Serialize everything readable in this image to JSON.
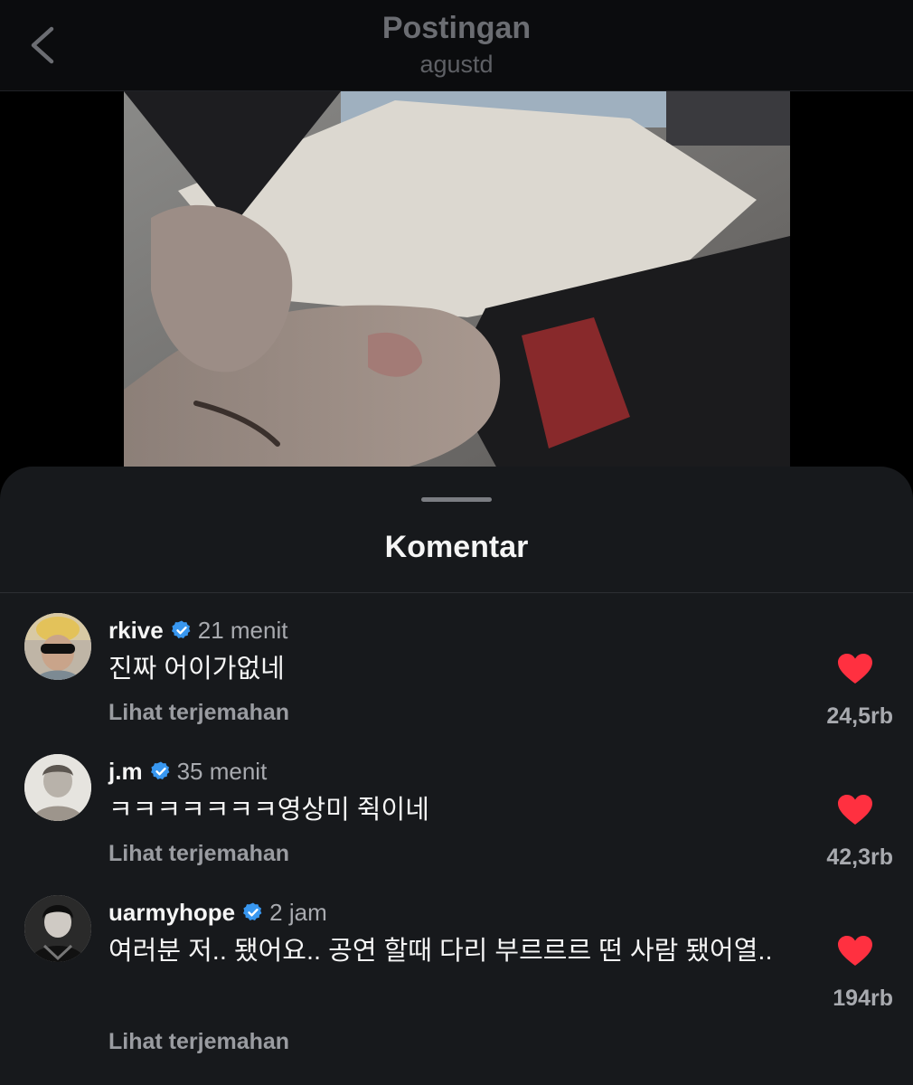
{
  "header": {
    "title": "Postingan",
    "subtitle": "agustd"
  },
  "sheet": {
    "title": "Komentar"
  },
  "comments": [
    {
      "username": "rkive",
      "verified": true,
      "time": "21 menit",
      "text": "진짜 어이가없네",
      "translate_label": "Lihat terjemahan",
      "likes": "24,5rb"
    },
    {
      "username": "j.m",
      "verified": true,
      "time": "35 menit",
      "text": "ㅋㅋㅋㅋㅋㅋㅋ영상미 쥑이네",
      "translate_label": "Lihat terjemahan",
      "likes": "42,3rb"
    },
    {
      "username": "uarmyhope",
      "verified": true,
      "time": "2 jam",
      "text": "여러분 저.. 됐어요.. 공연 할때 다리 부르르르 떤 사람 됐어열..",
      "translate_label": "Lihat terjemahan",
      "likes": "194rb"
    }
  ],
  "colors": {
    "verified_badge": "#3897f0",
    "like_heart": "#ff3040",
    "sheet_background": "#17191c"
  },
  "icons": {
    "back": "chevron-left-icon",
    "verified": "verified-badge-icon",
    "like": "heart-filled-icon"
  }
}
